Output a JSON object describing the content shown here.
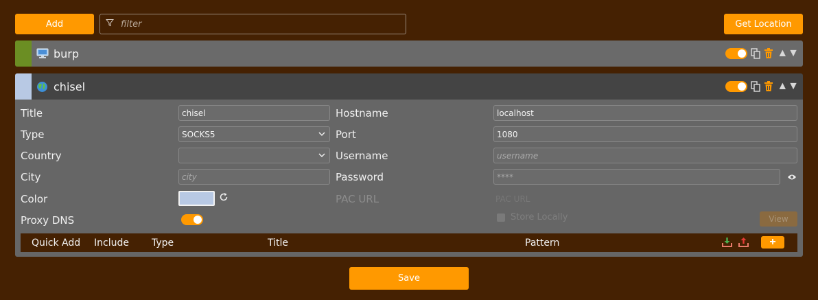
{
  "toolbar": {
    "add_label": "Add",
    "filter_placeholder": "filter",
    "get_location_label": "Get Location"
  },
  "proxies": [
    {
      "title": "burp",
      "stripe_color": "#6b8e23",
      "icon": "computer-icon",
      "enabled": true
    },
    {
      "title": "chisel",
      "stripe_color": "#b8c9e4",
      "icon": "globe-icon",
      "enabled": true
    }
  ],
  "details": {
    "labels": {
      "title": "Title",
      "type": "Type",
      "country": "Country",
      "city": "City",
      "color": "Color",
      "proxy_dns": "Proxy DNS",
      "hostname": "Hostname",
      "port": "Port",
      "username": "Username",
      "password": "Password",
      "pac_url": "PAC URL"
    },
    "values": {
      "title": "chisel",
      "type": "SOCKS5",
      "country": "",
      "hostname": "localhost",
      "port": "1080",
      "color": "#b8c9e4",
      "proxy_dns": true
    },
    "placeholders": {
      "city": "city",
      "username": "username",
      "password": "****",
      "pac_url": "PAC URL"
    },
    "store_locally_label": "Store Locally",
    "view_label": "View"
  },
  "pattern_header": {
    "quick_add": "Quick Add",
    "include": "Include",
    "type": "Type",
    "title": "Title",
    "pattern": "Pattern",
    "plus_label": "+"
  },
  "save_label": "Save"
}
